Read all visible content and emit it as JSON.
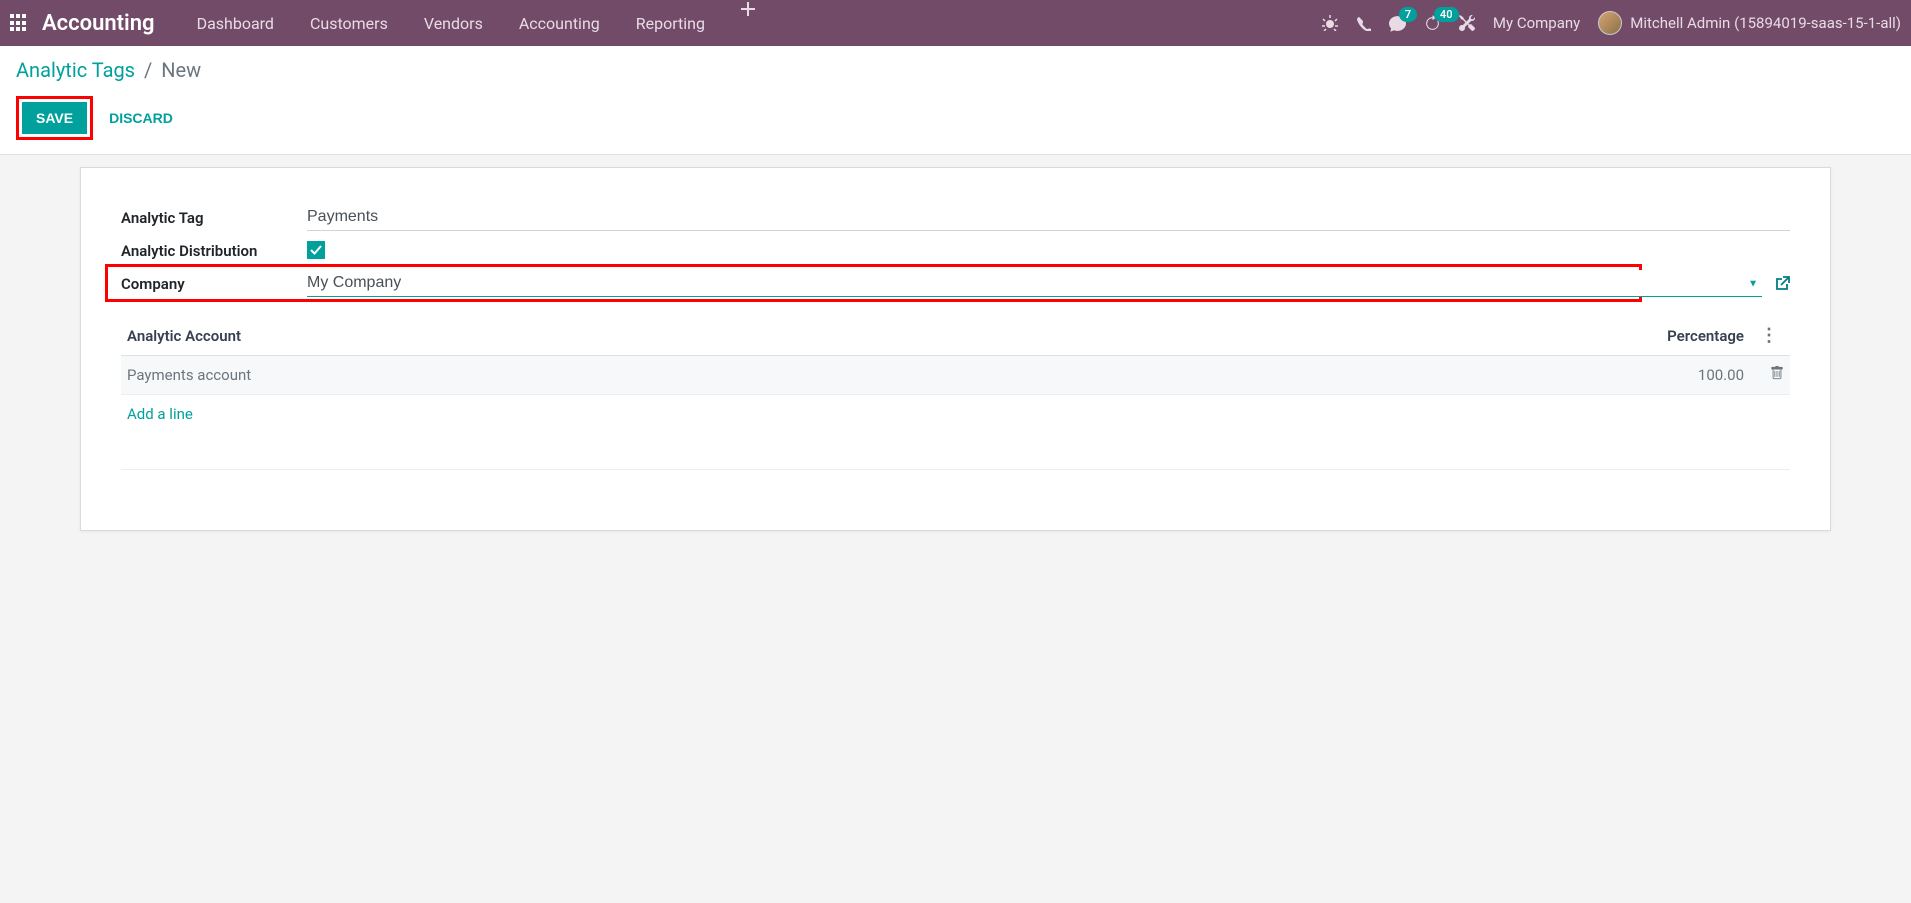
{
  "navbar": {
    "app_name": "Accounting",
    "menu": [
      "Dashboard",
      "Customers",
      "Vendors",
      "Accounting",
      "Reporting"
    ],
    "messages_badge": "7",
    "activities_badge": "40",
    "company": "My Company",
    "user": "Mitchell Admin (15894019-saas-15-1-all)"
  },
  "breadcrumb": {
    "parent": "Analytic Tags",
    "sep": "/",
    "current": "New"
  },
  "buttons": {
    "save": "SAVE",
    "discard": "DISCARD"
  },
  "form": {
    "tag_label": "Analytic Tag",
    "tag_value": "Payments",
    "dist_label": "Analytic Distribution",
    "dist_checked": true,
    "company_label": "Company",
    "company_value": "My Company"
  },
  "table": {
    "col_account": "Analytic Account",
    "col_percent": "Percentage",
    "rows": [
      {
        "account": "Payments account",
        "percent": "100.00"
      }
    ],
    "add_line": "Add a line"
  }
}
